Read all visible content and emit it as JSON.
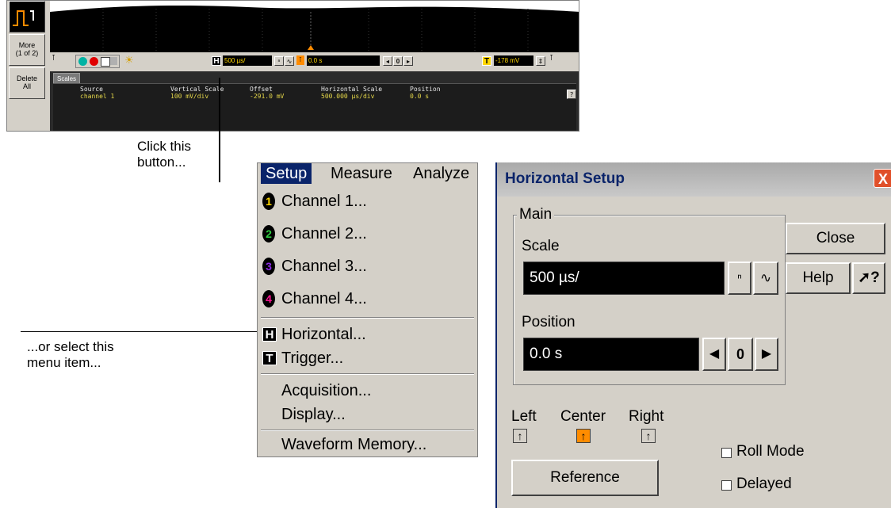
{
  "scope": {
    "side_buttons": {
      "more_line1": "More",
      "more_line2": "(1 of 2)",
      "delete_line1": "Delete",
      "delete_line2": "All"
    },
    "toolbar": {
      "timebase_value": "500 µs/",
      "position_value": "0.0 s",
      "position_zero": "0",
      "trigger_level": "-178 mV",
      "h_label": "H",
      "t_label": "T"
    },
    "scales": {
      "tab_label": "Scales",
      "headers": [
        "Source",
        "Vertical Scale",
        "Offset",
        "Horizontal Scale",
        "Position"
      ],
      "values": [
        "channel 1",
        "100 mV/div",
        "-291.0 mV",
        "500.000 µs/div",
        "0.0 s"
      ],
      "help_glyph": "?"
    }
  },
  "callouts": {
    "click_button_line1": "Click this",
    "click_button_line2": "button...",
    "select_menu_line1": "...or select this",
    "select_menu_line2": "menu item..."
  },
  "menu": {
    "menubar": [
      "Setup",
      "Measure",
      "Analyze"
    ],
    "channels": [
      {
        "num": "1",
        "label": "Channel 1...",
        "color": "#ffd700"
      },
      {
        "num": "2",
        "label": "Channel 2...",
        "color": "#2ecc40"
      },
      {
        "num": "3",
        "label": "Channel 3...",
        "color": "#8a2be2"
      },
      {
        "num": "4",
        "label": "Channel 4...",
        "color": "#ff1493"
      }
    ],
    "horizontal_icon": "H",
    "horizontal": "Horizontal...",
    "trigger_icon": "T",
    "trigger": "Trigger...",
    "acquisition": "Acquisition...",
    "display": "Display...",
    "waveform_memory": "Waveform Memory..."
  },
  "dialog": {
    "title": "Horizontal Setup",
    "close_x": "X",
    "group_main": "Main",
    "scale_label": "Scale",
    "scale_value": "500 µs/",
    "position_label": "Position",
    "position_value": "0.0 s",
    "position_zero": "0",
    "close_button": "Close",
    "help_button": "Help",
    "whats_this": "?",
    "reference_left": "Left",
    "reference_center": "Center",
    "reference_right": "Right",
    "reference_button": "Reference",
    "roll_mode": "Roll Mode",
    "delayed": "Delayed",
    "accent_color": "#ff8c00",
    "titlebar_color": "#0a246a"
  }
}
